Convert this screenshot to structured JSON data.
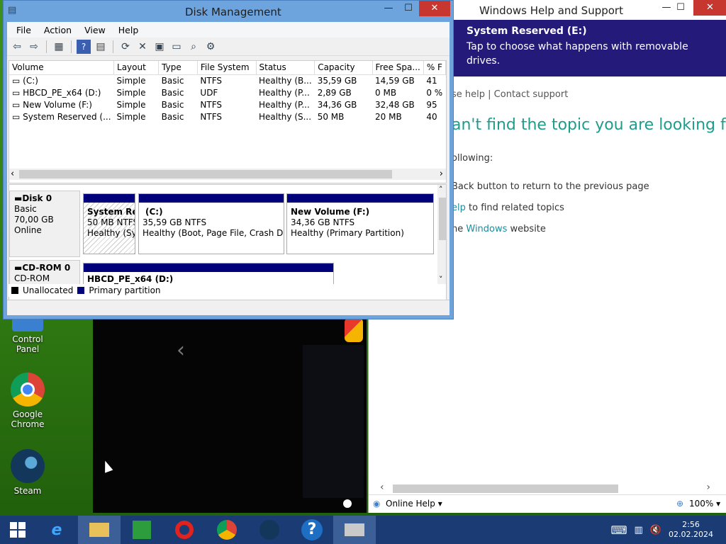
{
  "desktop": {
    "icons": [
      {
        "label": "Control Panel"
      },
      {
        "label": "Google Chrome"
      },
      {
        "label": "Steam"
      }
    ]
  },
  "disk_mgmt": {
    "title": "Disk Management",
    "menu": [
      "File",
      "Action",
      "View",
      "Help"
    ],
    "columns": [
      "Volume",
      "Layout",
      "Type",
      "File System",
      "Status",
      "Capacity",
      "Free Spa...",
      "% F"
    ],
    "rows": [
      {
        "volume": "(C:)",
        "layout": "Simple",
        "type": "Basic",
        "fs": "NTFS",
        "status": "Healthy (B...",
        "capacity": "35,59 GB",
        "free": "14,59 GB",
        "pct": "41"
      },
      {
        "volume": "HBCD_PE_x64 (D:)",
        "layout": "Simple",
        "type": "Basic",
        "fs": "UDF",
        "status": "Healthy (P...",
        "capacity": "2,89 GB",
        "free": "0 MB",
        "pct": "0 %"
      },
      {
        "volume": "New Volume (F:)",
        "layout": "Simple",
        "type": "Basic",
        "fs": "NTFS",
        "status": "Healthy (P...",
        "capacity": "34,36 GB",
        "free": "32,48 GB",
        "pct": "95"
      },
      {
        "volume": "System Reserved (...",
        "layout": "Simple",
        "type": "Basic",
        "fs": "NTFS",
        "status": "Healthy (S...",
        "capacity": "50 MB",
        "free": "20 MB",
        "pct": "40"
      }
    ],
    "disk0": {
      "name": "Disk 0",
      "type": "Basic",
      "size": "70,00 GB",
      "state": "Online"
    },
    "partitions": [
      {
        "name": "System Res",
        "size": "50 MB NTFS",
        "status": "Healthy (Sys"
      },
      {
        "name": "(C:)",
        "size": "35,59 GB NTFS",
        "status": "Healthy (Boot, Page File, Crash Dump"
      },
      {
        "name": "New Volume  (F:)",
        "size": "34,36 GB NTFS",
        "status": "Healthy (Primary Partition)"
      }
    ],
    "cdrom": {
      "name": "CD-ROM 0",
      "type": "CD-ROM",
      "partition": "HBCD_PE_x64  (D:)"
    },
    "legend": [
      {
        "label": "Unallocated",
        "color": "#000000"
      },
      {
        "label": "Primary partition",
        "color": "#00007a"
      }
    ]
  },
  "toast": {
    "title": "System Reserved (E:)",
    "body": "Tap to choose what happens with removable drives."
  },
  "help": {
    "title": "Windows Help and Support",
    "crumbs_prefix": "se help",
    "crumbs_sep": " | ",
    "crumbs_contact": "Contact support",
    "heading": "an't find the topic you are looking for",
    "intro": "ollowing:",
    "bullet1": "Back button to return to the previous page",
    "bullet2_link": "elp",
    "bullet2_rest": " to find related topics",
    "bullet3_pre": "ne ",
    "bullet3_link": "Windows",
    "bullet3_rest": " website",
    "online_help": "Online Help",
    "zoom": "100%"
  },
  "taskbar": {
    "time": "2:56",
    "date": "02.02.2024"
  }
}
